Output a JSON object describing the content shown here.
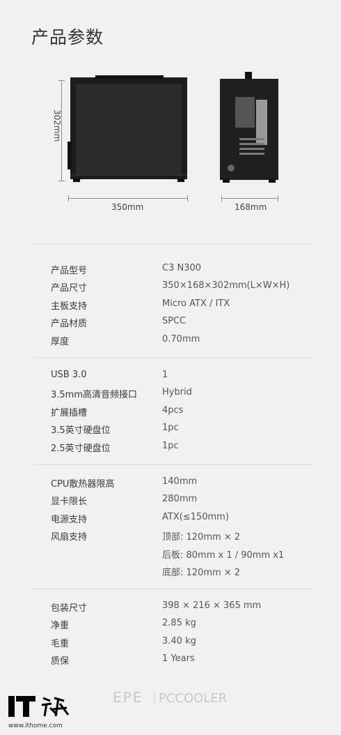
{
  "page": {
    "title": "产品参数"
  },
  "dimensions": {
    "height": "302mm",
    "width": "350mm",
    "depth": "168mm"
  },
  "spec_groups": [
    [
      {
        "k": "产品型号",
        "v": "C3 N300"
      },
      {
        "k": "产品尺寸",
        "v": "350×168×302mm(L×W×H)"
      },
      {
        "k": "主板支持",
        "v": "Micro ATX / ITX"
      },
      {
        "k": "产品材质",
        "v": "SPCC"
      },
      {
        "k": "厚度",
        "v": "0.70mm"
      }
    ],
    [
      {
        "k": "USB 3.0",
        "v": "1"
      },
      {
        "k": "3.5mm高清音频接口",
        "v": "Hybrid"
      },
      {
        "k": "扩展插槽",
        "v": "4pcs"
      },
      {
        "k": "3.5英寸硬盘位",
        "v": "1pc"
      },
      {
        "k": "2.5英寸硬盘位",
        "v": "1pc"
      }
    ],
    [
      {
        "k": "CPU散热器限高",
        "v": "140mm"
      },
      {
        "k": "显卡限长",
        "v": "280mm"
      },
      {
        "k": "电源支持",
        "v": "ATX(≤150mm)"
      },
      {
        "k": "风扇支持",
        "v": "顶部: 120mm × 2"
      },
      {
        "k": "",
        "v": "后板: 80mm x 1 / 90mm x1"
      },
      {
        "k": "",
        "v": "底部: 120mm × 2"
      }
    ],
    [
      {
        "k": "包装尺寸",
        "v": "398 × 216 × 365 mm"
      },
      {
        "k": "净重",
        "v": "2.85 kg"
      },
      {
        "k": "毛重",
        "v": "3.40 kg"
      },
      {
        "k": "质保",
        "v": "1 Years"
      }
    ]
  ],
  "footer": {
    "brand_left": "EPE",
    "brand_right": "PCCOOLER",
    "it_logo_text": "IT之家",
    "site": "www.ithome.com"
  }
}
